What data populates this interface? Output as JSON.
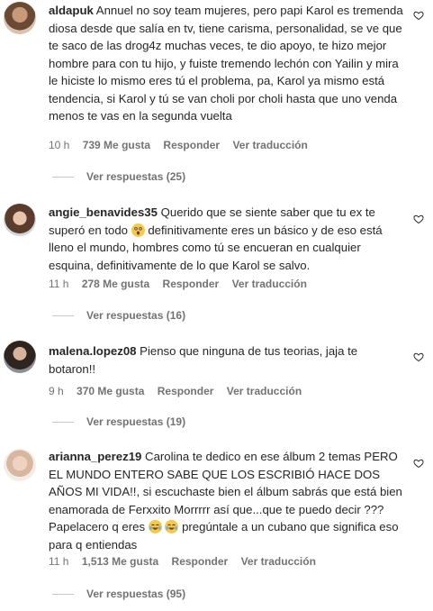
{
  "comments": [
    {
      "username": "aldapuk",
      "text": "Annuel no soy team mujeres, pero papi Karol es tremenda diosa desde que salía en tv, tiene carisma, personalidad, se ve que te saco de las drog4z muchas veces, te dio apoyo, te hizo mejor hombre para con tu hijo, y fuiste tremendo lechón con Yailin y mira le hiciste lo mismo eres tú el problema, pa, Karol ya mismo está tendencia, si Karol y tú se van choli por choli hasta que uno venda menos te vas en la segunda vuelta",
      "time": "10 h",
      "likes": "739 Me gusta",
      "reply": "Responder",
      "translate": "Ver traducción",
      "replies": "Ver respuestas (25)"
    },
    {
      "username": "angie_benavides35",
      "text_before_emoji": "Querido que se siente saber que tu ex te superó en todo",
      "text_after_emoji": "definitivamente eres un básico y de eso está lleno el mundo, hombres como tú se encueran en cualquier esquina, definitivamente de lo que Karol se salvo.",
      "time": "11 h",
      "likes": "278 Me gusta",
      "reply": "Responder",
      "translate": "Ver traducción",
      "replies": "Ver respuestas (16)"
    },
    {
      "username": "malena.lopez08",
      "text": "Pienso que ninguna de tus teorias, jaja te botaron!!",
      "time": "9 h",
      "likes": "370 Me gusta",
      "reply": "Responder",
      "translate": "Ver traducción",
      "replies": "Ver respuestas (19)"
    },
    {
      "username": "arianna_perez19",
      "text_before_emoji": "Carolina te dedico en ese álbum 2 temas PERO EL MUNDO ENTERO SABE QUE LOS ESCRIBIÓ HACE DOS AÑOS MI VIDA!!, si escuchaste bien el álbum sabrás que está bien enamorada de Ferxxito Morrrrr así que...que te puedo decir ??? Papelacero q eres",
      "text_after_emoji": "pregúntale a un cubano que significa eso para q entiendas",
      "time": "11 h",
      "likes": "1,513 Me gusta",
      "reply": "Responder",
      "translate": "Ver traducción",
      "replies": "Ver respuestas (95)"
    }
  ],
  "icons": {
    "heart": "heart-outline-icon",
    "emoji_surprised": "astonished-face-icon",
    "emoji_laugh": "tears-of-joy-icon"
  },
  "colors": {
    "text": "#262626",
    "meta": "#737373"
  }
}
